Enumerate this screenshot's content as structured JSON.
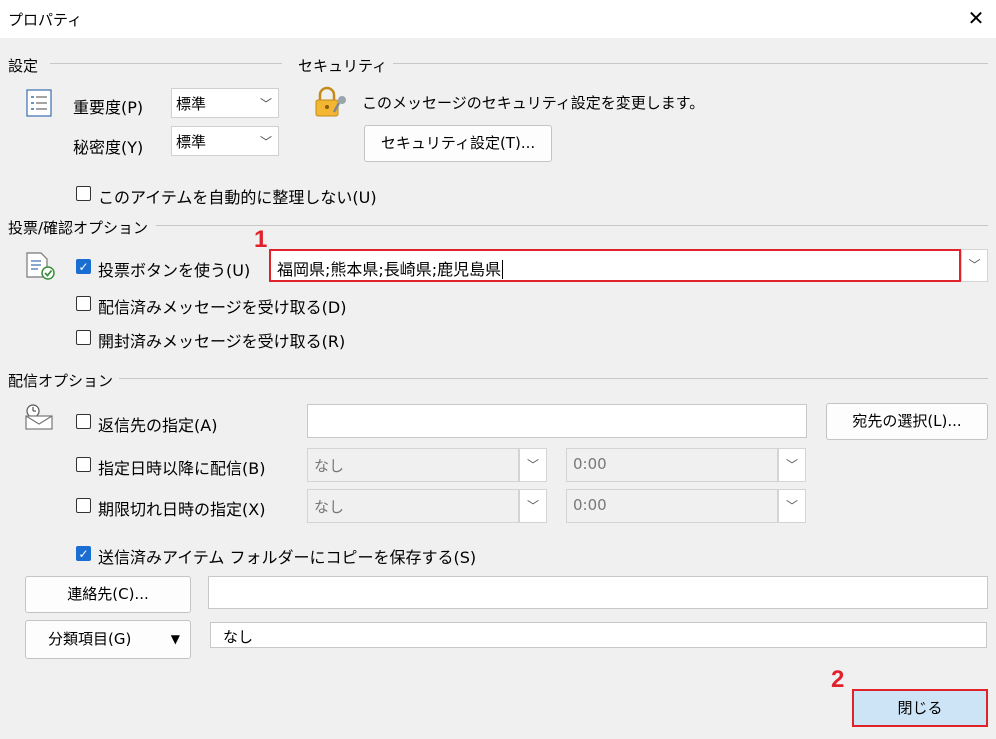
{
  "window": {
    "title": "プロパティ",
    "close_glyph": "✕"
  },
  "settings": {
    "section_label": "設定",
    "importance_label": "重要度(P)",
    "importance_value": "標準",
    "sensitivity_label": "秘密度(Y)",
    "sensitivity_value": "標準",
    "no_autoarchive_label": "このアイテムを自動的に整理しない(U)"
  },
  "security": {
    "section_label": "セキュリティ",
    "message": "このメッセージのセキュリティ設定を変更します。",
    "settings_button": "セキュリティ設定(T)..."
  },
  "voting": {
    "section_label": "投票/確認オプション",
    "use_voting_label": "投票ボタンを使う(U)",
    "use_voting_checked": true,
    "voting_value": "福岡県;熊本県;長崎県;鹿児島県",
    "delivery_receipt_label": "配信済みメッセージを受け取る(D)",
    "read_receipt_label": "開封済みメッセージを受け取る(R)"
  },
  "delivery": {
    "section_label": "配信オプション",
    "reply_to_label": "返信先の指定(A)",
    "reply_to_value": "",
    "select_names_button": "宛先の選択(L)...",
    "deliver_after_label": "指定日時以降に配信(B)",
    "deliver_after_date": "なし",
    "deliver_after_time": "0:00",
    "expires_label": "期限切れ日時の指定(X)",
    "expires_date": "なし",
    "expires_time": "0:00",
    "save_copy_label": "送信済みアイテム フォルダーにコピーを保存する(S)",
    "save_copy_checked": true
  },
  "contacts": {
    "button": "連絡先(C)...",
    "value": ""
  },
  "categories": {
    "button": "分類項目(G)",
    "value": "なし"
  },
  "footer": {
    "close_button": "閉じる"
  },
  "annotations": {
    "marker_1": "1",
    "marker_2": "2",
    "highlight_color": "#e0232b"
  },
  "colors": {
    "accent": "#1a6dd1",
    "close_button_bg": "#cde4f7",
    "close_button_border": "#2b7fd6"
  }
}
